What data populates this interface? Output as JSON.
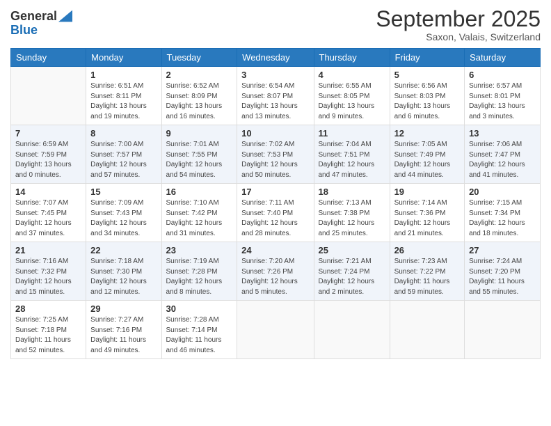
{
  "logo": {
    "line1": "General",
    "line2": "Blue"
  },
  "header": {
    "month": "September 2025",
    "location": "Saxon, Valais, Switzerland"
  },
  "weekdays": [
    "Sunday",
    "Monday",
    "Tuesday",
    "Wednesday",
    "Thursday",
    "Friday",
    "Saturday"
  ],
  "weeks": [
    [
      {
        "day": "",
        "info": ""
      },
      {
        "day": "1",
        "info": "Sunrise: 6:51 AM\nSunset: 8:11 PM\nDaylight: 13 hours\nand 19 minutes."
      },
      {
        "day": "2",
        "info": "Sunrise: 6:52 AM\nSunset: 8:09 PM\nDaylight: 13 hours\nand 16 minutes."
      },
      {
        "day": "3",
        "info": "Sunrise: 6:54 AM\nSunset: 8:07 PM\nDaylight: 13 hours\nand 13 minutes."
      },
      {
        "day": "4",
        "info": "Sunrise: 6:55 AM\nSunset: 8:05 PM\nDaylight: 13 hours\nand 9 minutes."
      },
      {
        "day": "5",
        "info": "Sunrise: 6:56 AM\nSunset: 8:03 PM\nDaylight: 13 hours\nand 6 minutes."
      },
      {
        "day": "6",
        "info": "Sunrise: 6:57 AM\nSunset: 8:01 PM\nDaylight: 13 hours\nand 3 minutes."
      }
    ],
    [
      {
        "day": "7",
        "info": "Sunrise: 6:59 AM\nSunset: 7:59 PM\nDaylight: 13 hours\nand 0 minutes."
      },
      {
        "day": "8",
        "info": "Sunrise: 7:00 AM\nSunset: 7:57 PM\nDaylight: 12 hours\nand 57 minutes."
      },
      {
        "day": "9",
        "info": "Sunrise: 7:01 AM\nSunset: 7:55 PM\nDaylight: 12 hours\nand 54 minutes."
      },
      {
        "day": "10",
        "info": "Sunrise: 7:02 AM\nSunset: 7:53 PM\nDaylight: 12 hours\nand 50 minutes."
      },
      {
        "day": "11",
        "info": "Sunrise: 7:04 AM\nSunset: 7:51 PM\nDaylight: 12 hours\nand 47 minutes."
      },
      {
        "day": "12",
        "info": "Sunrise: 7:05 AM\nSunset: 7:49 PM\nDaylight: 12 hours\nand 44 minutes."
      },
      {
        "day": "13",
        "info": "Sunrise: 7:06 AM\nSunset: 7:47 PM\nDaylight: 12 hours\nand 41 minutes."
      }
    ],
    [
      {
        "day": "14",
        "info": "Sunrise: 7:07 AM\nSunset: 7:45 PM\nDaylight: 12 hours\nand 37 minutes."
      },
      {
        "day": "15",
        "info": "Sunrise: 7:09 AM\nSunset: 7:43 PM\nDaylight: 12 hours\nand 34 minutes."
      },
      {
        "day": "16",
        "info": "Sunrise: 7:10 AM\nSunset: 7:42 PM\nDaylight: 12 hours\nand 31 minutes."
      },
      {
        "day": "17",
        "info": "Sunrise: 7:11 AM\nSunset: 7:40 PM\nDaylight: 12 hours\nand 28 minutes."
      },
      {
        "day": "18",
        "info": "Sunrise: 7:13 AM\nSunset: 7:38 PM\nDaylight: 12 hours\nand 25 minutes."
      },
      {
        "day": "19",
        "info": "Sunrise: 7:14 AM\nSunset: 7:36 PM\nDaylight: 12 hours\nand 21 minutes."
      },
      {
        "day": "20",
        "info": "Sunrise: 7:15 AM\nSunset: 7:34 PM\nDaylight: 12 hours\nand 18 minutes."
      }
    ],
    [
      {
        "day": "21",
        "info": "Sunrise: 7:16 AM\nSunset: 7:32 PM\nDaylight: 12 hours\nand 15 minutes."
      },
      {
        "day": "22",
        "info": "Sunrise: 7:18 AM\nSunset: 7:30 PM\nDaylight: 12 hours\nand 12 minutes."
      },
      {
        "day": "23",
        "info": "Sunrise: 7:19 AM\nSunset: 7:28 PM\nDaylight: 12 hours\nand 8 minutes."
      },
      {
        "day": "24",
        "info": "Sunrise: 7:20 AM\nSunset: 7:26 PM\nDaylight: 12 hours\nand 5 minutes."
      },
      {
        "day": "25",
        "info": "Sunrise: 7:21 AM\nSunset: 7:24 PM\nDaylight: 12 hours\nand 2 minutes."
      },
      {
        "day": "26",
        "info": "Sunrise: 7:23 AM\nSunset: 7:22 PM\nDaylight: 11 hours\nand 59 minutes."
      },
      {
        "day": "27",
        "info": "Sunrise: 7:24 AM\nSunset: 7:20 PM\nDaylight: 11 hours\nand 55 minutes."
      }
    ],
    [
      {
        "day": "28",
        "info": "Sunrise: 7:25 AM\nSunset: 7:18 PM\nDaylight: 11 hours\nand 52 minutes."
      },
      {
        "day": "29",
        "info": "Sunrise: 7:27 AM\nSunset: 7:16 PM\nDaylight: 11 hours\nand 49 minutes."
      },
      {
        "day": "30",
        "info": "Sunrise: 7:28 AM\nSunset: 7:14 PM\nDaylight: 11 hours\nand 46 minutes."
      },
      {
        "day": "",
        "info": ""
      },
      {
        "day": "",
        "info": ""
      },
      {
        "day": "",
        "info": ""
      },
      {
        "day": "",
        "info": ""
      }
    ]
  ]
}
